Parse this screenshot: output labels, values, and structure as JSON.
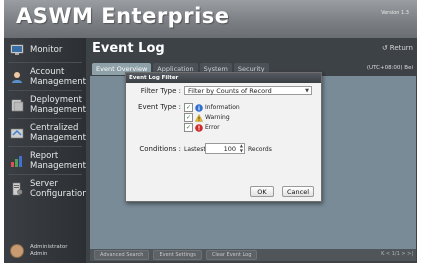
{
  "app": {
    "brand": "ASWM Enterprise",
    "version": "Version 1.3"
  },
  "sidebar": {
    "items": [
      {
        "label": "Monitor",
        "icon": "monitor-icon"
      },
      {
        "label": "Account\nManagement",
        "icon": "account-icon"
      },
      {
        "label": "Deployment\nManagement",
        "icon": "deployment-icon"
      },
      {
        "label": "Centralized\nManagement",
        "icon": "centralized-icon"
      },
      {
        "label": "Report\nManagement",
        "icon": "report-icon"
      },
      {
        "label": "Server\nConfiguration",
        "icon": "server-config-icon"
      }
    ],
    "footer": {
      "line1": "Administrator",
      "line2": "Admin"
    }
  },
  "main": {
    "title": "Event Log",
    "return_label": "Return",
    "tabs": [
      "Event Overview",
      "Application",
      "System",
      "Security"
    ],
    "active_tab": 0,
    "timezone": "(UTC+08:00) Bei",
    "bottom_buttons": [
      "Advanced Search",
      "Event Settings",
      "Clear Event Log"
    ],
    "pager": "K < 1/1 > >|"
  },
  "dialog": {
    "title": "Event Log Filter",
    "filter_type_label": "Filter Type :",
    "filter_type_value": "Filter by Counts of Record",
    "event_type_label": "Event Type :",
    "event_types": [
      {
        "label": "Information",
        "checked": true,
        "icon": "information-icon",
        "color": "#2f6fd0"
      },
      {
        "label": "Warning",
        "checked": true,
        "icon": "warning-icon",
        "color": "#e8b92a"
      },
      {
        "label": "Error",
        "checked": true,
        "icon": "error-icon",
        "color": "#cc2a2a"
      }
    ],
    "conditions_label": "Conditions :",
    "conditions_prefix": "Lastest",
    "conditions_value": "100",
    "conditions_suffix": "Records",
    "ok_label": "OK",
    "cancel_label": "Cancel"
  }
}
